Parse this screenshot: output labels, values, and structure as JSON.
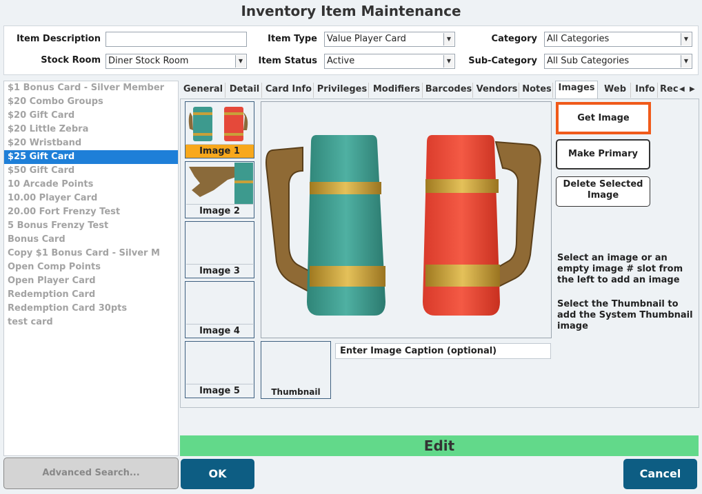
{
  "title": "Inventory Item Maintenance",
  "filters": {
    "item_description_label": "Item Description",
    "item_description_value": "",
    "stock_room_label": "Stock Room",
    "stock_room_value": "Diner Stock Room",
    "item_type_label": "Item Type",
    "item_type_value": "Value Player Card",
    "item_status_label": "Item Status",
    "item_status_value": "Active",
    "category_label": "Category",
    "category_value": "All Categories",
    "sub_category_label": "Sub-Category",
    "sub_category_value": "All Sub Categories"
  },
  "items": [
    {
      "label": "$1 Bonus Card -  Silver Member",
      "selected": false
    },
    {
      "label": "$20 Combo Groups",
      "selected": false
    },
    {
      "label": "$20 Gift Card",
      "selected": false
    },
    {
      "label": "$20 Little Zebra",
      "selected": false
    },
    {
      "label": "$20 Wristband",
      "selected": false
    },
    {
      "label": "$25 Gift Card",
      "selected": true
    },
    {
      "label": "$50 Gift Card",
      "selected": false
    },
    {
      "label": "10 Arcade Points",
      "selected": false
    },
    {
      "label": "10.00 Player Card",
      "selected": false
    },
    {
      "label": "20.00 Fort Frenzy Test",
      "selected": false
    },
    {
      "label": "5 Bonus Frenzy Test",
      "selected": false
    },
    {
      "label": "Bonus Card",
      "selected": false
    },
    {
      "label": "Copy $1 Bonus Card -  Silver M",
      "selected": false
    },
    {
      "label": "Open Comp Points",
      "selected": false
    },
    {
      "label": "Open Player Card",
      "selected": false
    },
    {
      "label": "Redemption Card",
      "selected": false
    },
    {
      "label": "Redemption Card 30pts",
      "selected": false
    },
    {
      "label": "test card",
      "selected": false
    }
  ],
  "tabs": [
    {
      "label": "General"
    },
    {
      "label": "Detail"
    },
    {
      "label": "Card Info"
    },
    {
      "label": "Privileges"
    },
    {
      "label": "Modifiers"
    },
    {
      "label": "Barcodes"
    },
    {
      "label": "Vendors"
    },
    {
      "label": "Notes"
    },
    {
      "label": "Images",
      "active": true
    },
    {
      "label": "Web"
    },
    {
      "label": "Info"
    },
    {
      "label": "Rec"
    }
  ],
  "tab_nav": {
    "prev_icon": "triangle-left-icon",
    "next_icon": "triangle-right-icon",
    "prev": "◀",
    "next": "▶"
  },
  "images": {
    "slots": [
      {
        "label": "Image 1",
        "selected": true
      },
      {
        "label": "Image 2",
        "selected": false
      },
      {
        "label": "Image 3",
        "selected": false
      },
      {
        "label": "Image 4",
        "selected": false
      },
      {
        "label": "Image 5",
        "selected": false
      }
    ],
    "thumbnail_label": "Thumbnail",
    "caption_placeholder": "Enter Image Caption (optional)",
    "get_image": "Get Image",
    "make_primary": "Make Primary",
    "delete_selected_line1": "Delete Selected",
    "delete_selected_line2": "Image",
    "help1": "Select an image or an empty image # slot from the left to add an image",
    "help2": "Select the Thumbnail to add the System Thumbnail image"
  },
  "mode": "Edit",
  "buttons": {
    "advanced_search": "Advanced Search...",
    "ok": "OK",
    "cancel": "Cancel"
  },
  "colors": {
    "selected_row": "#1e7fd8",
    "selected_slot": "#f8a81c",
    "edit_bar": "#62d98a",
    "primary_button": "#0d5d83",
    "highlight_border": "#f05a1a"
  }
}
